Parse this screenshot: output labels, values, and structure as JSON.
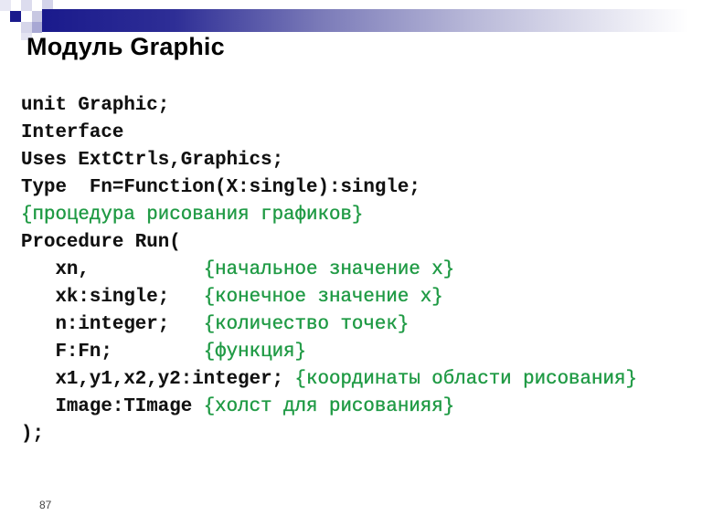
{
  "slide": {
    "title": "Модуль Graphic",
    "page_number": "87",
    "accent_color": "#1a1a8c",
    "comment_color": "#1f9a44"
  },
  "code": {
    "lines": [
      {
        "code": "unit Graphic;",
        "comment": ""
      },
      {
        "code": "Interface",
        "comment": ""
      },
      {
        "code": "Uses ExtCtrls,Graphics;",
        "comment": ""
      },
      {
        "code": "Type  Fn=Function(X:single):single;",
        "comment": ""
      },
      {
        "code": "",
        "comment": "{процедура рисования графиков}"
      },
      {
        "code": "Procedure Run(",
        "comment": ""
      },
      {
        "code": "   xn,          ",
        "comment": "{начальное значение x}"
      },
      {
        "code": "   xk:single;   ",
        "comment": "{конечное значение x}"
      },
      {
        "code": "   n:integer;   ",
        "comment": "{количество точек}"
      },
      {
        "code": "   F:Fn;        ",
        "comment": "{функция}"
      },
      {
        "code": "   x1,y1,x2,y2:integer; ",
        "comment": "{координаты области рисования}"
      },
      {
        "code": "   Image:TImage ",
        "comment": "{холст для рисованияя}"
      },
      {
        "code": ");",
        "comment": ""
      }
    ]
  }
}
